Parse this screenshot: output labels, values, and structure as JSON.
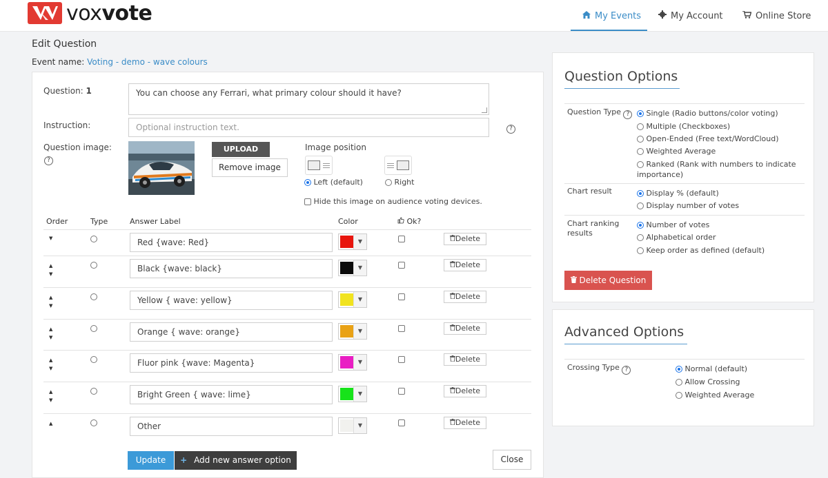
{
  "brand": {
    "logo_text_light": "vox",
    "logo_text_bold": "vote",
    "accent": "#3a8cc7"
  },
  "nav": {
    "my_events": "My Events",
    "my_account": "My Account",
    "online_store": "Online Store"
  },
  "page": {
    "title": "Edit Question",
    "event_label": "Event name:",
    "event_name": "Voting - demo - wave colours"
  },
  "question": {
    "label": "Question:",
    "number": "1",
    "text": "You can choose any Ferrari, what primary colour should it have?",
    "instruction_label": "Instruction:",
    "instruction_placeholder": "Optional instruction text.",
    "image_label": "Question image:",
    "upload_label": "UPLOAD",
    "remove_label": "Remove image",
    "image_position_label": "Image position",
    "pos_left_label": "Left (default)",
    "pos_right_label": "Right",
    "hide_image_label": "Hide this image on audience voting devices."
  },
  "table": {
    "headers": {
      "order": "Order",
      "type": "Type",
      "answer": "Answer Label",
      "color": "Color",
      "ok": "Ok?"
    },
    "delete_label": "Delete",
    "rows": [
      {
        "label": "Red {wave: Red}",
        "color": "#e8160e"
      },
      {
        "label": "Black {wave: black}",
        "color": "#0a0a0a"
      },
      {
        "label": "Yellow { wave: yellow}",
        "color": "#f1e31f"
      },
      {
        "label": "Orange { wave: orange}",
        "color": "#e9a216"
      },
      {
        "label": "Fluor pink {wave: Magenta}",
        "color": "#e91ec3"
      },
      {
        "label": "Bright Green { wave: lime}",
        "color": "#17e31a"
      },
      {
        "label": "Other",
        "color": "#f1f1ee"
      }
    ]
  },
  "actions": {
    "update": "Update",
    "add_answer": "Add new answer option",
    "close": "Close"
  },
  "question_options": {
    "title": "Question Options",
    "type_label": "Question Type",
    "types": [
      "Single (Radio buttons/color voting)",
      "Multiple (Checkboxes)",
      "Open-Ended (Free text/WordCloud)",
      "Weighted Average",
      "Ranked (Rank with numbers to indicate",
      "importance)"
    ],
    "chart_result_label": "Chart result",
    "chart_results": [
      "Display % (default)",
      "Display number of votes"
    ],
    "ranking_label_1": "Chart ranking",
    "ranking_label_2": "results",
    "rankings": [
      "Number of votes",
      "Alphabetical order",
      "Keep order as defined (default)"
    ],
    "delete_question": "Delete Question"
  },
  "advanced_options": {
    "title": "Advanced Options",
    "crossing_label": "Crossing Type",
    "crossing": [
      "Normal (default)",
      "Allow Crossing",
      "Weighted Average"
    ]
  }
}
